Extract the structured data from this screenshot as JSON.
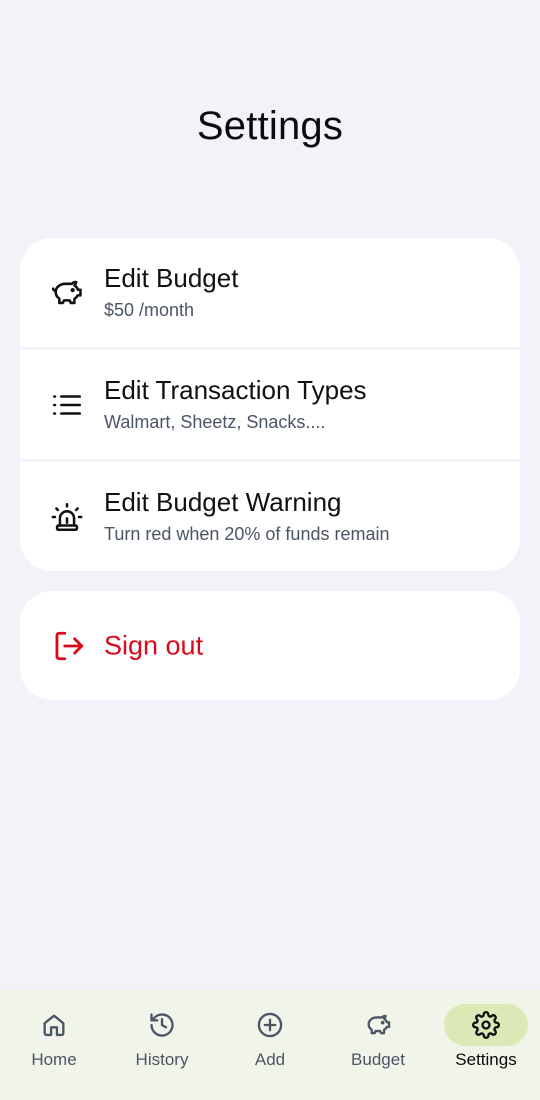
{
  "page": {
    "title": "Settings"
  },
  "settings": {
    "items": [
      {
        "title": "Edit Budget",
        "subtitle": "$50 /month",
        "icon": "piggy-bank-icon"
      },
      {
        "title": "Edit Transaction Types",
        "subtitle": "Walmart, Sheetz, Snacks....",
        "icon": "list-icon"
      },
      {
        "title": "Edit Budget Warning",
        "subtitle": "Turn red when 20% of funds remain",
        "icon": "siren-icon"
      }
    ]
  },
  "signout": {
    "label": "Sign out",
    "icon": "log-out-icon",
    "color": "#d8091b"
  },
  "nav": {
    "items": [
      {
        "label": "Home",
        "icon": "home-icon"
      },
      {
        "label": "History",
        "icon": "history-icon"
      },
      {
        "label": "Add",
        "icon": "plus-circle-icon"
      },
      {
        "label": "Budget",
        "icon": "piggy-bank-icon"
      },
      {
        "label": "Settings",
        "icon": "gear-icon",
        "active": true
      }
    ],
    "active_color": "#dce9b7"
  }
}
